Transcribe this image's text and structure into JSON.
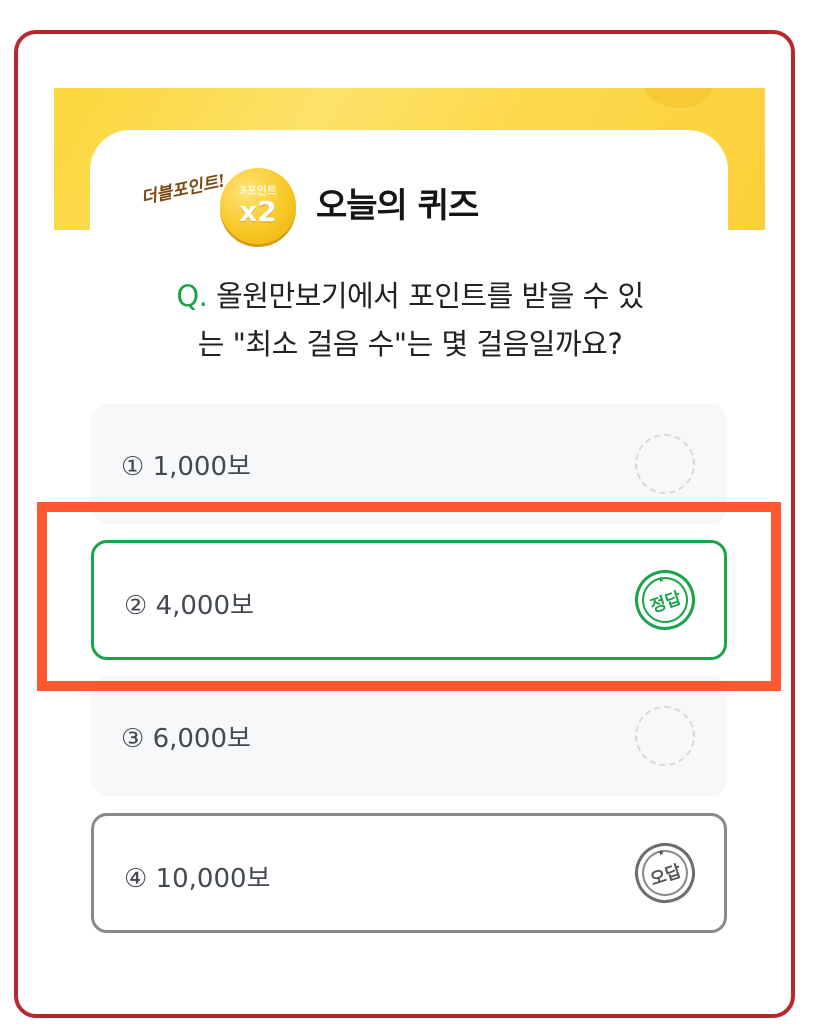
{
  "header": {
    "badge_script": "더블포인트!",
    "coin_top": "3포인트",
    "coin_multiplier": "x2",
    "title": "오늘의 퀴즈"
  },
  "question": {
    "prefix": "Q.",
    "line1": "올원만보기에서 포인트를 받을 수 있",
    "line2": "는 \"최소 걸음 수\"는 몇 걸음일까요?"
  },
  "options": [
    {
      "label": "① 1,000보",
      "state": "unselected"
    },
    {
      "label": "② 4,000보",
      "state": "correct",
      "stamp": "정답"
    },
    {
      "label": "③ 6,000보",
      "state": "unselected"
    },
    {
      "label": "④ 10,000보",
      "state": "wrong",
      "stamp": "오답"
    }
  ],
  "colors": {
    "frame_border": "#b7282e",
    "banner_yellow": "#fcd539",
    "correct_green": "#1ca44a",
    "wrong_gray": "#8a8a8a",
    "highlight_orange": "#ff5730"
  },
  "icons": {
    "coin": "gold-coin-icon",
    "correct_stamp": "correct-stamp-icon",
    "wrong_stamp": "wrong-stamp-icon",
    "empty_ring": "dashed-circle-icon"
  }
}
